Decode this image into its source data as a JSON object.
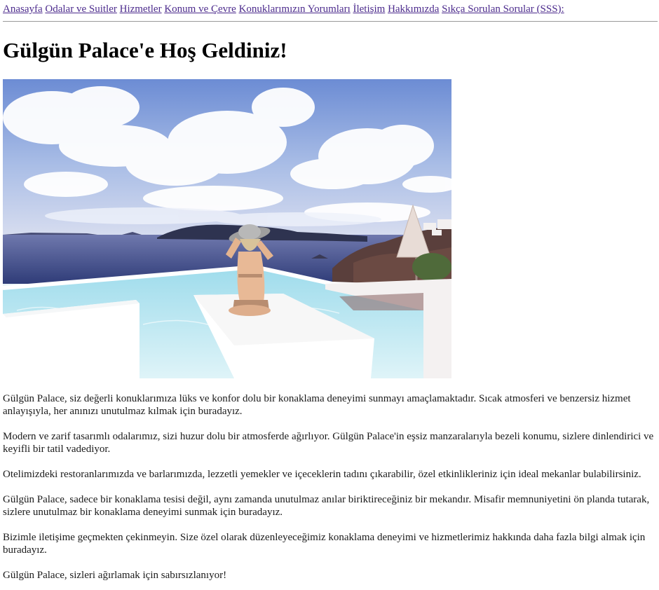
{
  "nav": [
    {
      "label": "Anasayfa"
    },
    {
      "label": "Odalar ve Suitler"
    },
    {
      "label": "Hizmetler"
    },
    {
      "label": "Konum ve Çevre"
    },
    {
      "label": "Konuklarımızın Yorumları"
    },
    {
      "label": "İletişim"
    },
    {
      "label": "Hakkımızda"
    },
    {
      "label": "Sıkça Sorulan Sorular (SSS):"
    }
  ],
  "page_title": "Gülgün Palace'e Hoş Geldiniz!",
  "paragraphs": [
    "Gülgün Palace, siz değerli konuklarımıza lüks ve konfor dolu bir konaklama deneyimi sunmayı amaçlamaktadır. Sıcak atmosferi ve benzersiz hizmet anlayışıyla, her anınızı unutulmaz kılmak için buradayız.",
    "Modern ve zarif tasarımlı odalarımız, sizi huzur dolu bir atmosferde ağırlıyor. Gülgün Palace'in eşsiz manzaralarıyla bezeli konumu, sizlere dinlendirici ve keyifli bir tatil vadediyor.",
    "Otelimizdeki restoranlarımızda ve barlarımızda, lezzetli yemekler ve içeceklerin tadını çıkarabilir, özel etkinlikleriniz için ideal mekanlar bulabilirsiniz.",
    "Gülgün Palace, sadece bir konaklama tesisi değil, aynı zamanda unutulmaz anılar biriktireceğiniz bir mekandır. Misafir memnuniyetini ön planda tutarak, sizlere unutulmaz bir konaklama deneyimi sunmak için buradayız.",
    "Bizimle iletişime geçmekten çekinmeyin. Size özel olarak düzenleyeceğimiz konaklama deneyimi ve hizmetlerimiz hakkında daha fazla bilgi almak için buradayız.",
    "Gülgün Palace, sizleri ağırlamak için sabırsızlanıyor!"
  ],
  "colors": {
    "link": "#4b2a8c",
    "sky_top": "#6f8fd6",
    "sea": "#3a4f8a",
    "pool": "#b9e6f0"
  }
}
